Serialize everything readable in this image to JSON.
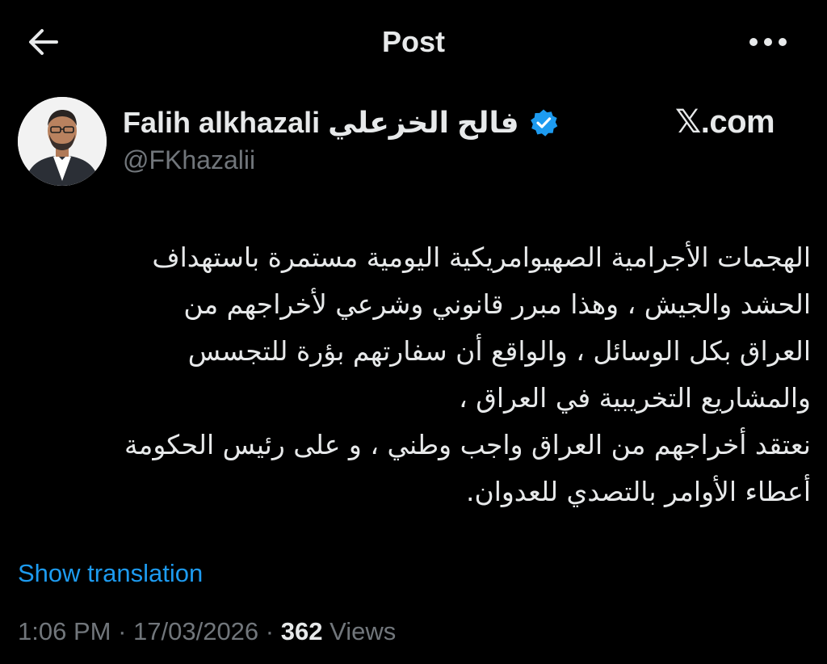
{
  "header": {
    "title": "Post",
    "back_icon": "back-arrow-icon",
    "more_icon": "more-horizontal-icon"
  },
  "author": {
    "display_name": "Falih alkhazali فالح الخزعلي",
    "handle": "@FKhazalii",
    "verified": true,
    "verified_color": "#1d9bf0"
  },
  "watermark": {
    "logo_letter": "𝕏",
    "text": ".com"
  },
  "tweet": {
    "lines": [
      "الهجمات الأجرامية الصهيوامريكية اليومية مستمرة باستهداف",
      "الحشد والجيش ، وهذا مبرر قانوني وشرعي لأخراجهم من",
      "العراق بكل الوسائل ، والواقع أن سفارتهم بؤرة للتجسس",
      "والمشاريع التخريبية في العراق ،",
      "نعتقد أخراجهم من العراق واجب وطني ، و على رئيس الحكومة",
      "أعطاء الأوامر بالتصدي للعدوان."
    ]
  },
  "translation": {
    "label": "Show translation",
    "color": "#1d9bf0"
  },
  "meta": {
    "time": "1:06 PM",
    "separator": " · ",
    "date": "17/03/2026",
    "views_count": "362",
    "views_label": " Views"
  },
  "colors": {
    "background": "#000000",
    "primary_text": "#e7e9ea",
    "secondary_text": "#71767b",
    "accent": "#1d9bf0"
  }
}
